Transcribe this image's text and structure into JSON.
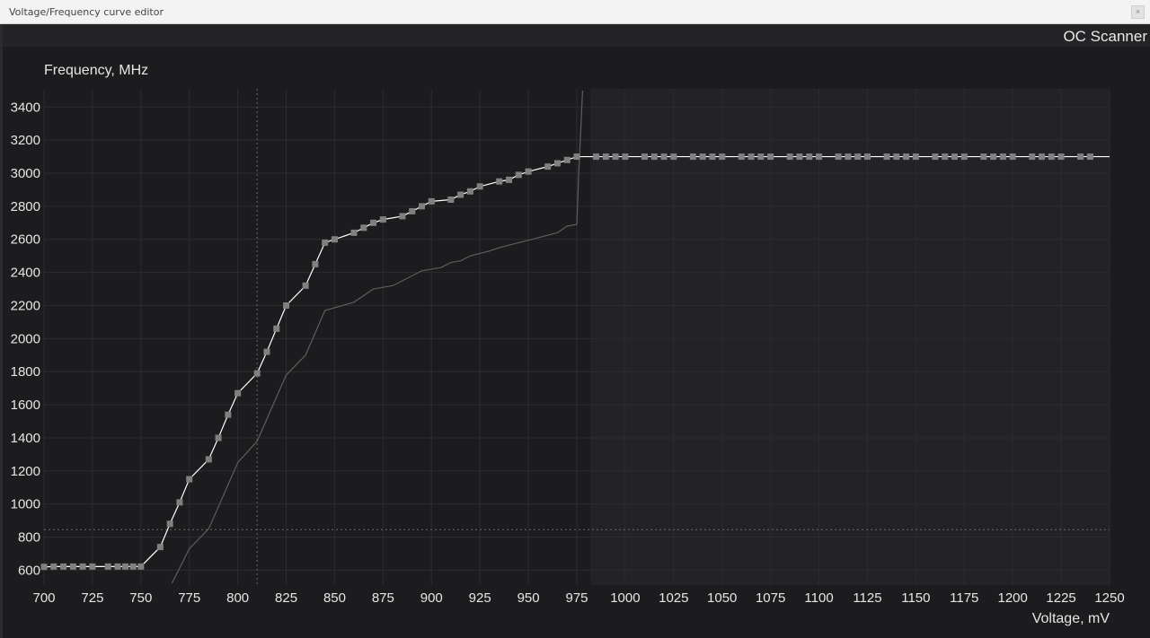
{
  "window": {
    "title": "Voltage/Frequency curve editor",
    "close_glyph": "×"
  },
  "toolbar": {
    "oc_scanner_label": "OC Scanner"
  },
  "colors": {
    "background": "#1c1c1e",
    "highlight_region": "#232327",
    "grid": "#2c2c2f",
    "curve": "#ffffff",
    "marker": "#808080",
    "reference_curve": "#5e5e5e"
  },
  "chart_data": {
    "type": "line",
    "title": "",
    "xlabel": "Voltage, mV",
    "ylabel": "Frequency, MHz",
    "xlim": [
      700,
      1250
    ],
    "ylim": [
      510,
      3510
    ],
    "x_ticks": [
      700,
      725,
      750,
      775,
      800,
      825,
      850,
      875,
      900,
      925,
      950,
      975,
      1000,
      1025,
      1050,
      1075,
      1100,
      1125,
      1150,
      1175,
      1200,
      1225,
      1250
    ],
    "y_ticks": [
      600,
      800,
      1000,
      1200,
      1400,
      1600,
      1800,
      2000,
      2200,
      2400,
      2600,
      2800,
      3000,
      3200,
      3400
    ],
    "grid": true,
    "highlight_x_from": 982,
    "crosshair": {
      "x": 810,
      "y": 845
    },
    "series": [
      {
        "role": "curve",
        "points": [
          [
            700,
            620
          ],
          [
            705,
            622
          ],
          [
            710,
            622
          ],
          [
            715,
            622
          ],
          [
            720,
            622
          ],
          [
            725,
            622
          ],
          [
            733,
            622
          ],
          [
            738,
            622
          ],
          [
            742,
            622
          ],
          [
            746,
            622
          ],
          [
            750,
            622
          ],
          [
            760,
            740
          ],
          [
            765,
            880
          ],
          [
            770,
            1010
          ],
          [
            775,
            1150
          ],
          [
            785,
            1270
          ],
          [
            790,
            1400
          ],
          [
            795,
            1540
          ],
          [
            800,
            1670
          ],
          [
            810,
            1790
          ],
          [
            815,
            1920
          ],
          [
            820,
            2060
          ],
          [
            825,
            2200
          ],
          [
            835,
            2320
          ],
          [
            840,
            2450
          ],
          [
            845,
            2580
          ],
          [
            850,
            2600
          ],
          [
            860,
            2640
          ],
          [
            865,
            2670
          ],
          [
            870,
            2700
          ],
          [
            875,
            2720
          ],
          [
            885,
            2740
          ],
          [
            890,
            2770
          ],
          [
            895,
            2800
          ],
          [
            900,
            2830
          ],
          [
            910,
            2840
          ],
          [
            915,
            2870
          ],
          [
            920,
            2890
          ],
          [
            925,
            2920
          ],
          [
            935,
            2950
          ],
          [
            940,
            2960
          ],
          [
            945,
            2990
          ],
          [
            950,
            3010
          ],
          [
            960,
            3040
          ],
          [
            965,
            3060
          ],
          [
            970,
            3080
          ],
          [
            975,
            3100
          ],
          [
            985,
            3100
          ],
          [
            990,
            3100
          ],
          [
            995,
            3100
          ],
          [
            1000,
            3100
          ],
          [
            1010,
            3100
          ],
          [
            1015,
            3100
          ],
          [
            1020,
            3100
          ],
          [
            1025,
            3100
          ],
          [
            1035,
            3100
          ],
          [
            1040,
            3100
          ],
          [
            1045,
            3100
          ],
          [
            1050,
            3100
          ],
          [
            1060,
            3100
          ],
          [
            1065,
            3100
          ],
          [
            1070,
            3100
          ],
          [
            1075,
            3100
          ],
          [
            1085,
            3100
          ],
          [
            1090,
            3100
          ],
          [
            1095,
            3100
          ],
          [
            1100,
            3100
          ],
          [
            1110,
            3100
          ],
          [
            1115,
            3100
          ],
          [
            1120,
            3100
          ],
          [
            1125,
            3100
          ],
          [
            1135,
            3100
          ],
          [
            1140,
            3100
          ],
          [
            1145,
            3100
          ],
          [
            1150,
            3100
          ],
          [
            1160,
            3100
          ],
          [
            1165,
            3100
          ],
          [
            1170,
            3100
          ],
          [
            1175,
            3100
          ],
          [
            1185,
            3100
          ],
          [
            1190,
            3100
          ],
          [
            1195,
            3100
          ],
          [
            1200,
            3100
          ],
          [
            1210,
            3100
          ],
          [
            1215,
            3100
          ],
          [
            1220,
            3100
          ],
          [
            1225,
            3100
          ],
          [
            1235,
            3100
          ],
          [
            1240,
            3100
          ],
          [
            1250,
            3100
          ]
        ]
      },
      {
        "role": "reference",
        "points": [
          [
            766,
            520
          ],
          [
            775,
            730
          ],
          [
            785,
            850
          ],
          [
            800,
            1250
          ],
          [
            810,
            1380
          ],
          [
            825,
            1780
          ],
          [
            835,
            1900
          ],
          [
            845,
            2170
          ],
          [
            860,
            2220
          ],
          [
            870,
            2300
          ],
          [
            880,
            2320
          ],
          [
            895,
            2410
          ],
          [
            905,
            2430
          ],
          [
            910,
            2460
          ],
          [
            915,
            2470
          ],
          [
            920,
            2500
          ],
          [
            930,
            2530
          ],
          [
            935,
            2550
          ],
          [
            945,
            2580
          ],
          [
            955,
            2610
          ],
          [
            965,
            2640
          ],
          [
            970,
            2680
          ],
          [
            975,
            2690
          ],
          [
            976,
            3000
          ],
          [
            978,
            3500
          ]
        ]
      }
    ]
  }
}
